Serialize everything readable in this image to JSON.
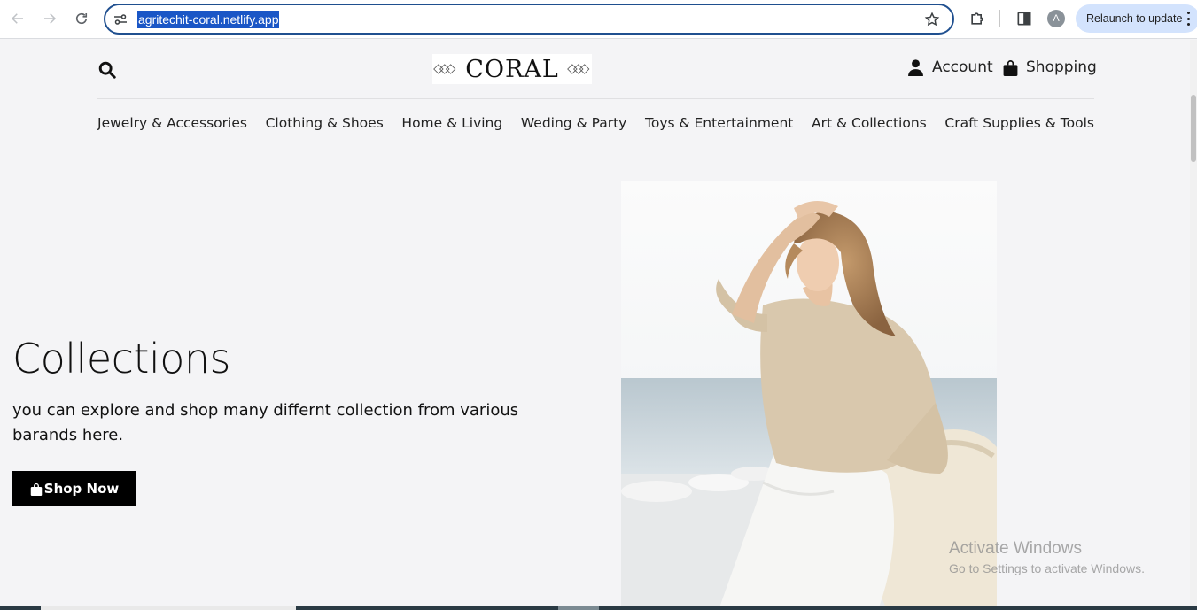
{
  "browser": {
    "url": "agritechit-coral.netlify.app",
    "profile_initial": "A",
    "relaunch_label": "Relaunch to update",
    "icons": [
      "back-icon",
      "forward-icon",
      "reload-icon",
      "site-settings-icon",
      "star-icon",
      "extensions-icon",
      "side-panel-icon",
      "more-icon"
    ]
  },
  "header": {
    "logo_text": "CORAL",
    "account_label": "Account",
    "shopping_label": "Shopping"
  },
  "categories": [
    "Jewelry & Accessories",
    "Clothing & Shoes",
    "Home & Living",
    "Weding & Party",
    "Toys & Entertainment",
    "Art & Collections",
    "Craft Supplies & Tools"
  ],
  "hero": {
    "title": "Collections",
    "subtitle": "you can explore and shop many differnt collection from various barands here.",
    "button_label": "Shop Now"
  },
  "watermark": {
    "line1": "Activate Windows",
    "line2": "Go to Settings to activate Windows."
  },
  "colors": {
    "page_bg": "#f4f4f6",
    "button_bg": "#000000",
    "omnibox_border": "#1f4f8f",
    "url_highlight": "#1a56c6",
    "relaunch_bg": "#d3e3fd"
  }
}
